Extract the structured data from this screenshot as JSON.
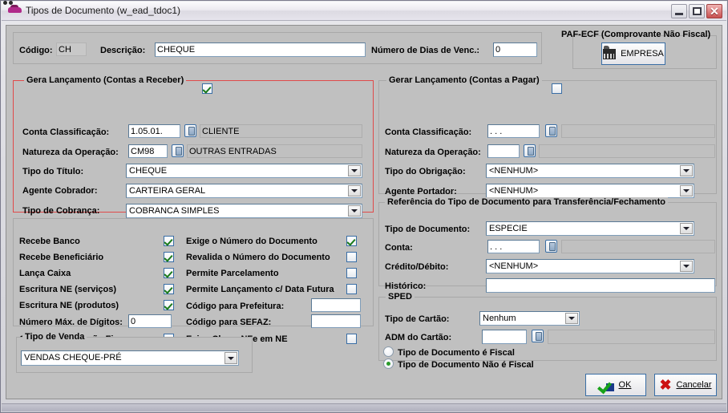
{
  "window": {
    "title": "Tipos de Documento (w_ead_tdoc1)",
    "icon": "car-icon",
    "minimize_label": "Minimizar",
    "maximize_label": "Maximizar",
    "close_label": "Fechar"
  },
  "header": {
    "codigo_label": "Código:",
    "codigo_value": "CH",
    "descricao_label": "Descrição:",
    "descricao_value": "CHEQUE",
    "dias_venc_label": "Número de Dias de Venc.:",
    "dias_venc_value": "0",
    "paf_title": "PAF-ECF (Comprovante Não Fiscal)",
    "empresa_button": "EMPRESA"
  },
  "receber": {
    "group_title": "Gera Lançamento (Contas a Receber)",
    "group_checked": true,
    "conta_classificacao_label": "Conta Classificação:",
    "conta_classificacao_value": "1.05.01.",
    "conta_classificacao_desc": "CLIENTE",
    "natureza_label": "Natureza da Operação:",
    "natureza_value": "CM98",
    "natureza_desc": "OUTRAS ENTRADAS",
    "tipo_titulo_label": "Tipo do Título:",
    "tipo_titulo_value": "CHEQUE",
    "agente_cobrador_label": "Agente Cobrador:",
    "agente_cobrador_value": "CARTEIRA GERAL",
    "tipo_cobranca_label": "Tipo de Cobrança:",
    "tipo_cobranca_value": "COBRANCA SIMPLES"
  },
  "pagar": {
    "group_title": "Gerar Lançamento (Contas a Pagar)",
    "group_checked": false,
    "conta_classificacao_label": "Conta Classificação:",
    "conta_classificacao_value": ". . .",
    "conta_classificacao_desc": "",
    "natureza_label": "Natureza da Operação:",
    "natureza_value": "",
    "natureza_desc": "",
    "tipo_obrigacao_label": "Tipo do Obrigação:",
    "tipo_obrigacao_value": "<NENHUM>",
    "agente_portador_label": "Agente Portador:",
    "agente_portador_value": "<NENHUM>"
  },
  "referencia": {
    "group_title": "Referência do Tipo de Documento para Transferência/Fechamento",
    "tipo_documento_label": "Tipo de Documento:",
    "tipo_documento_value": "ESPECIE",
    "conta_label": "Conta:",
    "conta_value": ". . .",
    "conta_desc": "",
    "credito_debito_label": "Crédito/Débito:",
    "credito_debito_value": "<NENHUM>",
    "historico_label": "Histórico:",
    "historico_value": ""
  },
  "sped": {
    "group_title": "SPED",
    "tipo_cartao_label": "Tipo de Cartão:",
    "tipo_cartao_value": "Nenhum",
    "adm_cartao_label": "ADM  do Cartão:",
    "adm_cartao_value": "",
    "adm_cartao_desc": "",
    "radio_fiscal_label": "Tipo de Documento é Fiscal",
    "radio_fiscal_selected": false,
    "radio_nao_fiscal_label": "Tipo de Documento Não é Fiscal",
    "radio_nao_fiscal_selected": true
  },
  "options_left": [
    {
      "label": "Recebe Banco",
      "checked": true
    },
    {
      "label": "Recebe Beneficiário",
      "checked": true
    },
    {
      "label": "Lança Caixa",
      "checked": true
    },
    {
      "label": "Escritura NE (serviços)",
      "checked": true
    },
    {
      "label": "Escritura NE (produtos)",
      "checked": true
    }
  ],
  "options_left_extra": {
    "num_max_digitos_label": "Número Máx. de Dígitos:",
    "num_max_digitos_value": "0",
    "conta_classificacao_fixa_label": "Conta Classificação Fixa",
    "conta_classificacao_fixa_checked": false
  },
  "options_right": [
    {
      "label": "Exige o Número do Documento",
      "checked": true
    },
    {
      "label": "Revalida o Número do Documento",
      "checked": false
    },
    {
      "label": "Permite Parcelamento",
      "checked": false
    },
    {
      "label": "Permite Lançamento c/ Data Futura",
      "checked": false
    }
  ],
  "options_right_extra": {
    "codigo_prefeitura_label": "Código para Prefeitura:",
    "codigo_prefeitura_value": "",
    "codigo_sefaz_label": "Código para SEFAZ:",
    "codigo_sefaz_value": "",
    "exige_chave_nfe_label": "Exige Chave NFe em NE",
    "exige_chave_nfe_checked": false
  },
  "tipo_venda": {
    "group_title": "Tipo de Venda",
    "value": "VENDAS CHEQUE-PRÉ"
  },
  "footer": {
    "ok_label": "OK",
    "cancel_label": "Cancelar"
  },
  "colors": {
    "accent_red": "#e04a4a",
    "check_green": "#1a7a1a",
    "field_border": "#7f9db9"
  }
}
